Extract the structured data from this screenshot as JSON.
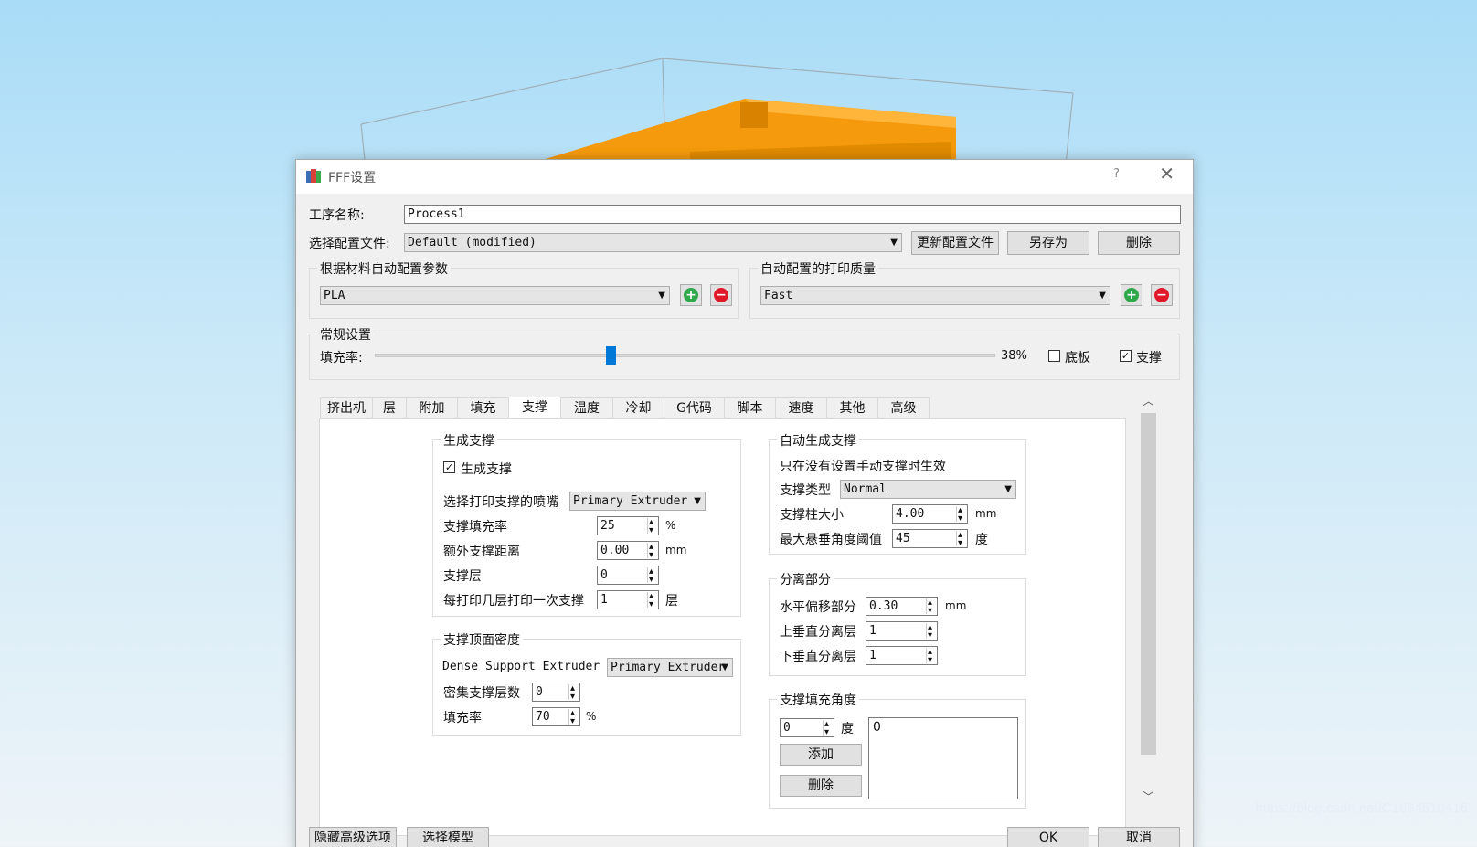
{
  "watermark": "https://blog.csdn.net/C1664510416",
  "dialog": {
    "title": "FFF设置",
    "help": "?",
    "close": "✕"
  },
  "process": {
    "name_label": "工序名称:",
    "name_value": "Process1",
    "profile_label": "选择配置文件:",
    "profile_value": "Default (modified)",
    "update_label": "更新配置文件",
    "save_as_label": "另存为",
    "delete_label": "删除"
  },
  "material": {
    "group_title": "根据材料自动配置参数",
    "value": "PLA"
  },
  "quality": {
    "group_title": "自动配置的打印质量",
    "value": "Fast"
  },
  "general": {
    "group_title": "常规设置",
    "infill_label": "填充率:",
    "infill_value": "38%",
    "infill_fraction": 0.38,
    "raft_label": "底板",
    "raft_checked": false,
    "support_label": "支撑",
    "support_checked": true
  },
  "tabs": [
    "挤出机",
    "层",
    "附加",
    "填充",
    "支撑",
    "温度",
    "冷却",
    "G代码",
    "脚本",
    "速度",
    "其他",
    "高级"
  ],
  "active_tab": "支撑",
  "gen_support": {
    "title": "生成支撑",
    "check_label": "生成支撑",
    "nozzle_label": "选择打印支撑的喷嘴",
    "nozzle_value": "Primary Extruder",
    "infill_label": "支撑填充率",
    "infill_value": "25",
    "infill_unit": "%",
    "extra_label": "额外支撑距离",
    "extra_value": "0.00",
    "extra_unit": "mm",
    "layers_label": "支撑层",
    "layers_value": "0",
    "every_label": "每打印几层打印一次支撑",
    "every_value": "1",
    "every_unit": "层"
  },
  "dense": {
    "title": "支撑顶面密度",
    "extruder_label": "Dense Support Extruder",
    "extruder_value": "Primary Extruder",
    "layers_label": "密集支撑层数",
    "layers_value": "0",
    "infill_label": "填充率",
    "infill_value": "70",
    "infill_unit": "%"
  },
  "auto_support": {
    "title": "自动生成支撑",
    "note": "只在没有设置手动支撑时生效",
    "type_label": "支撑类型",
    "type_value": "Normal",
    "pillar_label": "支撑柱大小",
    "pillar_value": "4.00",
    "pillar_unit": "mm",
    "angle_label": "最大悬垂角度阈值",
    "angle_value": "45",
    "angle_unit": "度"
  },
  "separation": {
    "title": "分离部分",
    "horiz_label": "水平偏移部分",
    "horiz_value": "0.30",
    "horiz_unit": "mm",
    "upper_label": "上垂直分离层",
    "upper_value": "1",
    "lower_label": "下垂直分离层",
    "lower_value": "1"
  },
  "fill_angle": {
    "title": "支撑填充角度",
    "value": "0",
    "unit": "度",
    "add_label": "添加",
    "remove_label": "删除",
    "list_item": "0"
  },
  "footer": {
    "hide_label": "隐藏高级选项",
    "select_label": "选择模型",
    "ok_label": "OK",
    "cancel_label": "取消"
  },
  "colors": {
    "sky": "#a9dcf7",
    "model": "#f59a0c",
    "accent": "#0078d7"
  }
}
